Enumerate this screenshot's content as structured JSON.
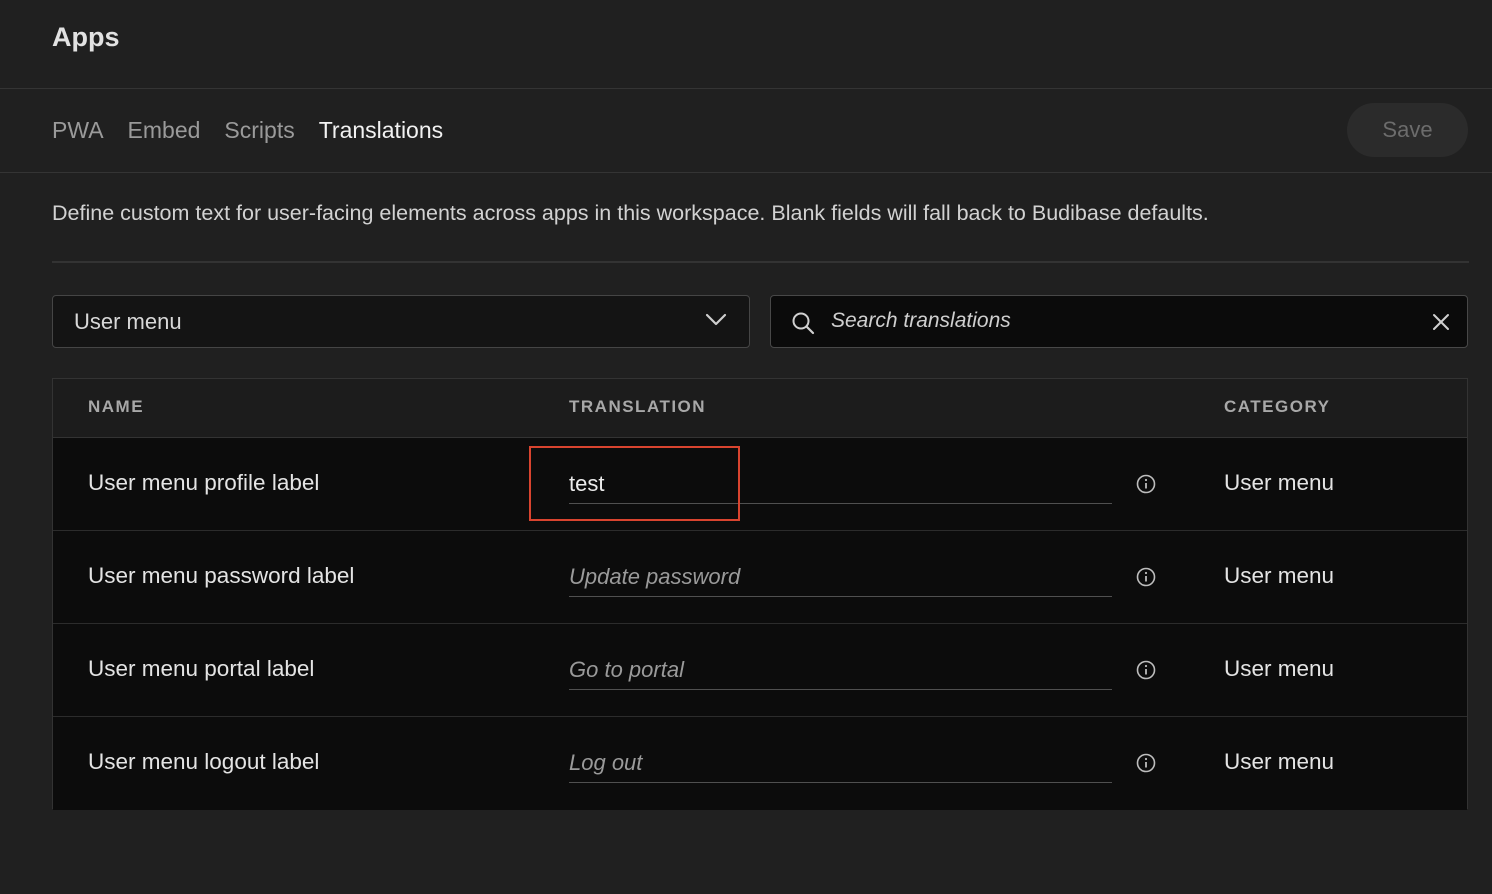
{
  "header": {
    "title": "Apps"
  },
  "tabs": [
    {
      "label": "PWA",
      "active": false
    },
    {
      "label": "Embed",
      "active": false
    },
    {
      "label": "Scripts",
      "active": false
    },
    {
      "label": "Translations",
      "active": true
    }
  ],
  "toolbar": {
    "save_label": "Save"
  },
  "description": "Define custom text for user-facing elements across apps in this workspace. Blank fields will fall back to Budibase defaults.",
  "filter": {
    "category_select": {
      "value": "User menu",
      "icon": "chevron-down-icon"
    },
    "search": {
      "placeholder": "Search translations",
      "value": "",
      "icon": "search-icon",
      "clear_icon": "close-icon"
    }
  },
  "table": {
    "columns": [
      "NAME",
      "TRANSLATION",
      "CATEGORY"
    ],
    "rows": [
      {
        "name": "User menu profile label",
        "value": "test",
        "placeholder": "",
        "category": "User menu"
      },
      {
        "name": "User menu password label",
        "value": "",
        "placeholder": "Update password",
        "category": "User menu"
      },
      {
        "name": "User menu portal label",
        "value": "",
        "placeholder": "Go to portal",
        "category": "User menu"
      },
      {
        "name": "User menu logout label",
        "value": "",
        "placeholder": "Log out",
        "category": "User menu"
      }
    ]
  },
  "colors": {
    "background": "#202020",
    "table_background": "#0c0c0c",
    "highlight": "#d9442f"
  }
}
